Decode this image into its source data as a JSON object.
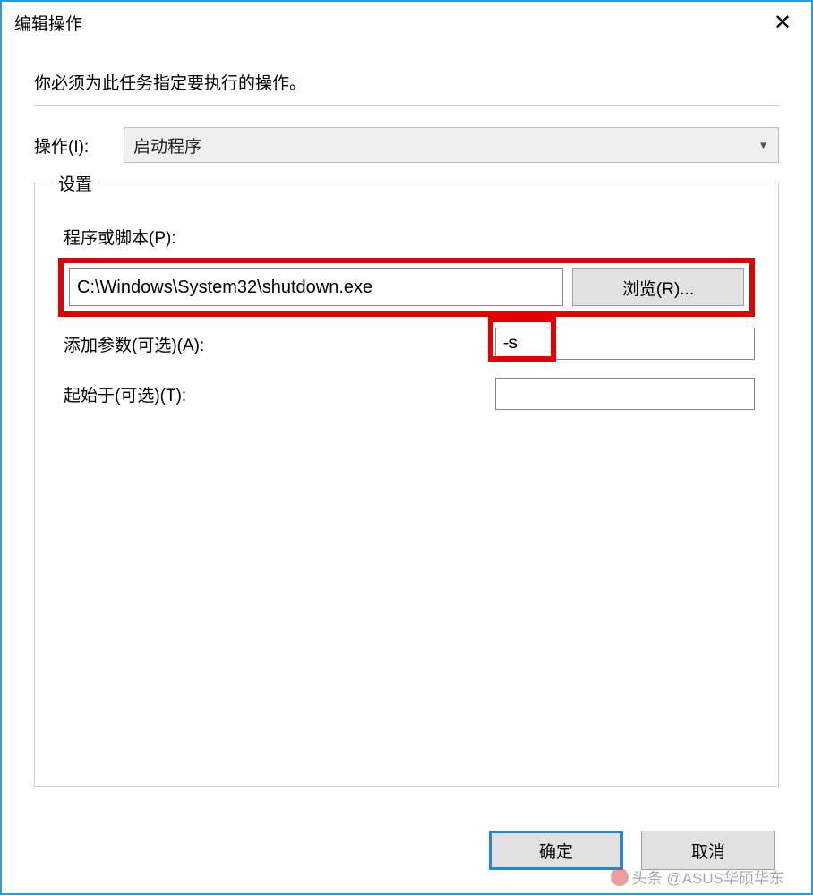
{
  "window": {
    "title": "编辑操作",
    "close_glyph": "✕"
  },
  "instruction": "你必须为此任务指定要执行的操作。",
  "action": {
    "label": "操作(I):",
    "selected": "启动程序"
  },
  "settings": {
    "legend": "设置",
    "program_label": "程序或脚本(P):",
    "program_value": "C:\\Windows\\System32\\shutdown.exe",
    "browse_label": "浏览(R)...",
    "args_label": "添加参数(可选)(A):",
    "args_value": "-s",
    "startin_label": "起始于(可选)(T):",
    "startin_value": ""
  },
  "buttons": {
    "ok": "确定",
    "cancel": "取消"
  },
  "watermark": "头条 @ASUS华硕华东"
}
